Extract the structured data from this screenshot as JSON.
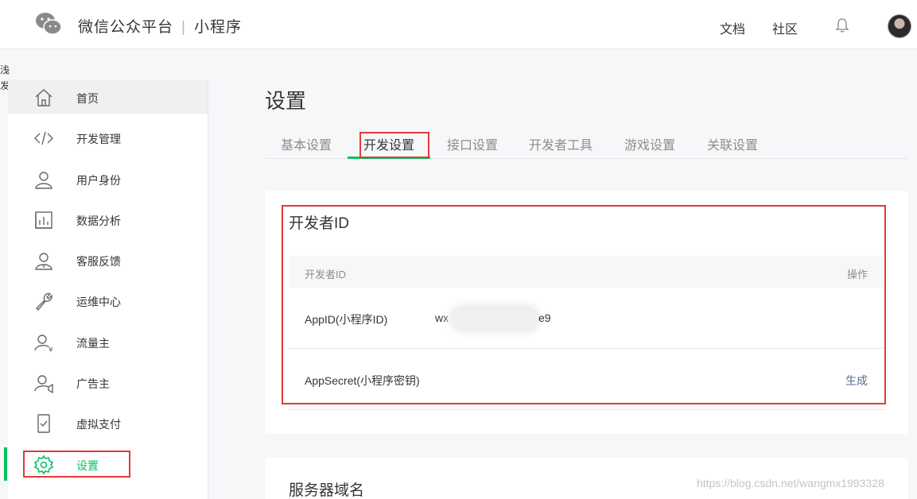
{
  "header": {
    "brand": "微信公众平台",
    "separator": "|",
    "product": "小程序",
    "links": [
      "文档",
      "社区"
    ],
    "icons": [
      "wechat-logo-icon",
      "bell-icon",
      "avatar"
    ]
  },
  "edge": [
    "浅",
    "发"
  ],
  "sidebar": {
    "items": [
      {
        "label": "首页",
        "icon": "home-icon"
      },
      {
        "label": "开发管理",
        "icon": "code-icon"
      },
      {
        "label": "用户身份",
        "icon": "user-icon"
      },
      {
        "label": "数据分析",
        "icon": "bar-chart-icon"
      },
      {
        "label": "客服反馈",
        "icon": "support-icon"
      },
      {
        "label": "运维中心",
        "icon": "wrench-icon"
      },
      {
        "label": "流量主",
        "icon": "user-yen-icon"
      },
      {
        "label": "广告主",
        "icon": "user-megaphone-icon"
      },
      {
        "label": "虚拟支付",
        "icon": "phone-check-icon"
      },
      {
        "label": "设置",
        "icon": "gear-icon"
      }
    ],
    "current": "设置"
  },
  "main": {
    "title": "设置",
    "tabs": [
      "基本设置",
      "开发设置",
      "接口设置",
      "开发者工具",
      "游戏设置",
      "关联设置"
    ],
    "active_tab": "开发设置",
    "developer_section": {
      "title": "开发者ID",
      "columns": [
        "开发者ID",
        "操作"
      ],
      "rows": [
        {
          "label": "AppID(小程序ID)",
          "value_start": "wx",
          "value_end": "e9",
          "action": ""
        },
        {
          "label": "AppSecret(小程序密钥)",
          "value_start": "",
          "value_end": "",
          "action": "生成"
        }
      ]
    },
    "server_section": {
      "title": "服务器域名"
    }
  },
  "watermark": "https://blog.csdn.net/wangmx1993328",
  "colors": {
    "accent": "#07c160",
    "link": "#576b95",
    "highlight_box": "#e23a3a"
  }
}
